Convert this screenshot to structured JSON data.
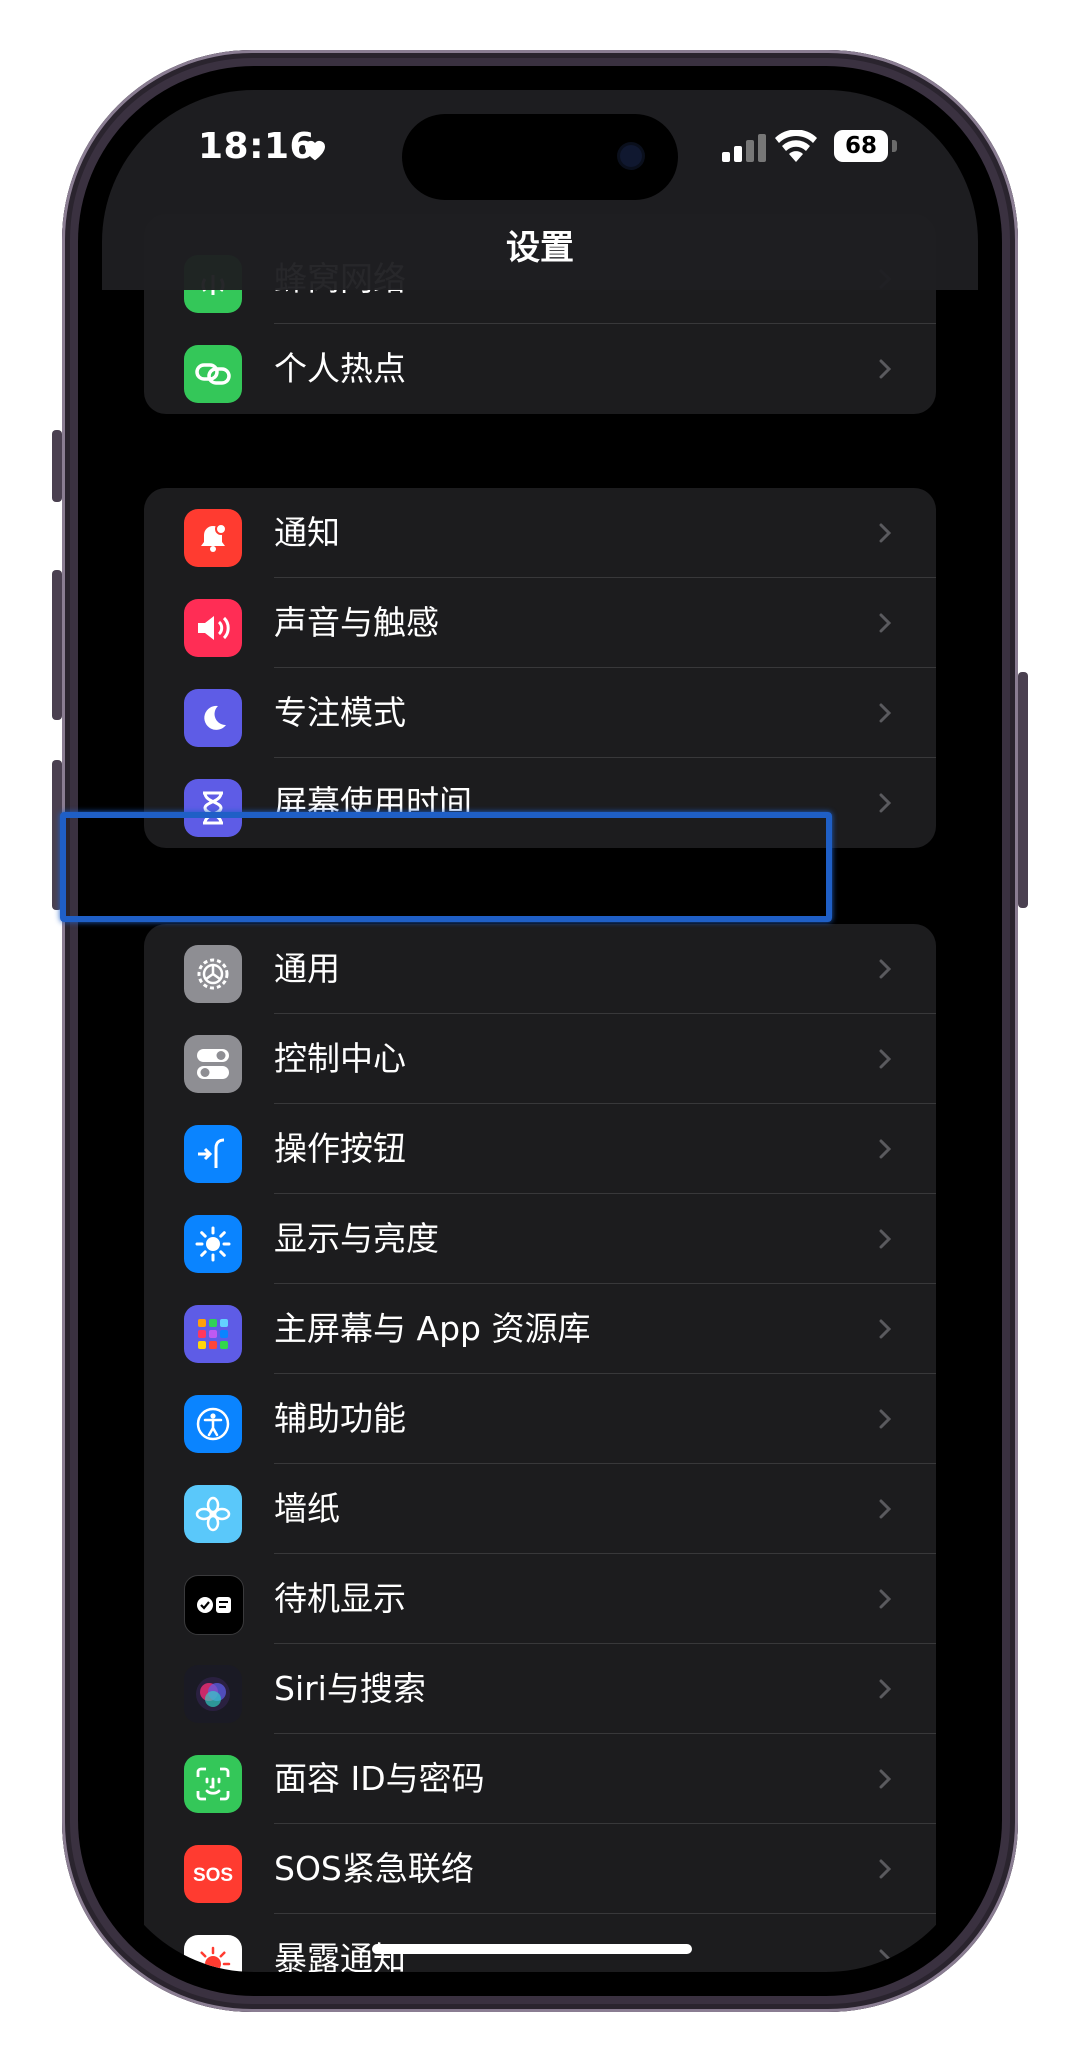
{
  "status_bar": {
    "time": "18:16",
    "battery": "68"
  },
  "header": {
    "title": "设置"
  },
  "groups": [
    {
      "items": [
        {
          "label": "蜂窝网络",
          "icon": "antenna-icon",
          "color": "#34c759"
        },
        {
          "label": "个人热点",
          "icon": "link-icon",
          "color": "#34c759"
        }
      ]
    },
    {
      "items": [
        {
          "label": "通知",
          "icon": "bell-icon",
          "color": "#ff3b30"
        },
        {
          "label": "声音与触感",
          "icon": "speaker-icon",
          "color": "#ff2d55"
        },
        {
          "label": "专注模式",
          "icon": "moon-icon",
          "color": "#5e5ce6"
        },
        {
          "label": "屏幕使用时间",
          "icon": "hourglass-icon",
          "color": "#5e5ce6"
        }
      ]
    },
    {
      "items": [
        {
          "label": "通用",
          "icon": "gear-icon",
          "color": "#8e8e93"
        },
        {
          "label": "控制中心",
          "icon": "toggles-icon",
          "color": "#8e8e93"
        },
        {
          "label": "操作按钮",
          "icon": "action-button-icon",
          "color": "#0a84ff"
        },
        {
          "label": "显示与亮度",
          "icon": "sun-icon",
          "color": "#0a84ff"
        },
        {
          "label": "主屏幕与 App 资源库",
          "icon": "app-grid-icon",
          "color": "#5e5ce6"
        },
        {
          "label": "辅助功能",
          "icon": "accessibility-icon",
          "color": "#0a84ff"
        },
        {
          "label": "墙纸",
          "icon": "flower-icon",
          "color": "#5ac8fa"
        },
        {
          "label": "待机显示",
          "icon": "standby-icon",
          "color": "#1c1c1e"
        },
        {
          "label": "Siri与搜索",
          "icon": "siri-icon",
          "color": "#2a2a3a"
        },
        {
          "label": "面容 ID与密码",
          "icon": "face-id-icon",
          "color": "#34c759"
        },
        {
          "label": "SOS紧急联络",
          "icon": "sos-icon",
          "color": "#ff3b30"
        },
        {
          "label": "暴露通知",
          "icon": "exposure-icon",
          "color": "#ffffff"
        }
      ]
    }
  ]
}
